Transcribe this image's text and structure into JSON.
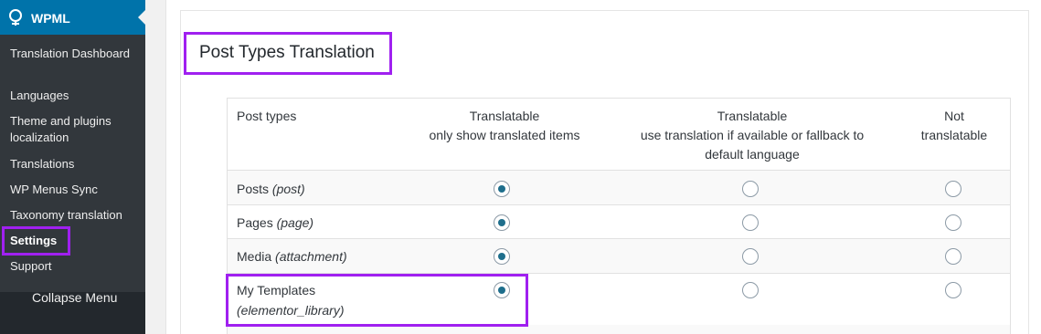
{
  "sidebar": {
    "plugin_title": "WPML",
    "items": [
      {
        "label": "Translation Dashboard"
      },
      {
        "label": "Languages"
      },
      {
        "label": "Theme and plugins localization"
      },
      {
        "label": "Translations"
      },
      {
        "label": "WP Menus Sync"
      },
      {
        "label": "Taxonomy translation"
      },
      {
        "label": "Settings",
        "active": true
      },
      {
        "label": "Support"
      }
    ],
    "collapse_label": "Collapse Menu"
  },
  "main": {
    "section_title": "Post Types Translation",
    "table": {
      "headers": {
        "post_types": "Post types",
        "translatable_title": "Translatable",
        "translatable_sub": "only show translated items",
        "fallback_title": "Translatable",
        "fallback_sub": "use translation if available or fallback to default language",
        "not_translatable": "Not translatable"
      },
      "rows": [
        {
          "name": "Posts",
          "slug": "(post)",
          "selected": "translatable"
        },
        {
          "name": "Pages",
          "slug": "(page)",
          "selected": "translatable"
        },
        {
          "name": "Media",
          "slug": "(attachment)",
          "selected": "translatable"
        },
        {
          "name": "My Templates",
          "slug": "(elementor_library)",
          "selected": "translatable"
        }
      ]
    }
  },
  "colors": {
    "sidebar_bg": "#23282d",
    "submenu_bg": "#32373c",
    "accent": "#0073aa",
    "highlight": "#a020f0"
  }
}
